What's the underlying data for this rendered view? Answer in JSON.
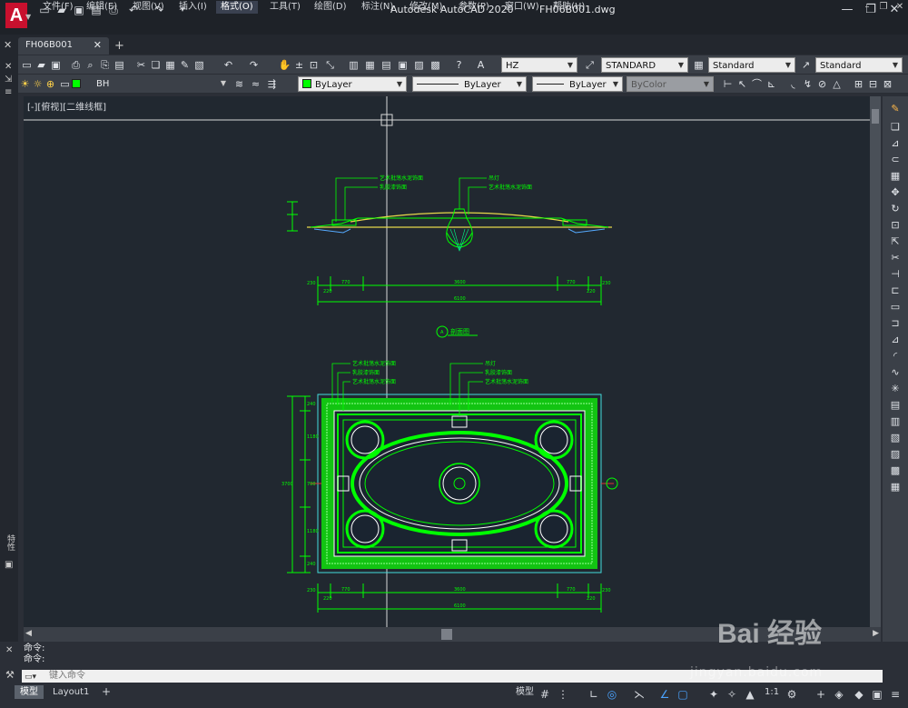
{
  "app": {
    "title": "Autodesk AutoCAD 2020",
    "file": "FH06B001.dwg"
  },
  "menu": [
    "文件(F)",
    "编辑(E)",
    "视图(V)",
    "插入(I)",
    "格式(O)",
    "工具(T)",
    "绘图(D)",
    "标注(N)",
    "修改(M)",
    "参数(P)",
    "窗口(W)",
    "帮助(H)"
  ],
  "menu_active": "格式(O)",
  "tabs": {
    "doc": "FH06B001",
    "add": "+"
  },
  "toolbar1": {
    "text_style": "HZ",
    "dim_style": "STANDARD",
    "table_style": "Standard",
    "mleader_style": "Standard"
  },
  "toolbar2": {
    "layer": "BH",
    "color": "ByLayer",
    "linetype": "ByLayer",
    "lineweight": "ByLayer",
    "plotstyle": "ByColor"
  },
  "viewport": {
    "label": "[-][俯视][二维线框]"
  },
  "drawing": {
    "elev_notes_left": [
      "艺术批荡水泥饰面",
      "乳胶漆饰面"
    ],
    "elev_notes_right": [
      "吊灯",
      "艺术批荡水泥饰面"
    ],
    "dims_top": [
      "230",
      "770",
      "3600",
      "770",
      "230"
    ],
    "dims_top_inner_left": "220",
    "dims_top_inner_right": "220",
    "total_width": "6100",
    "section_title": "剖面图",
    "section_mark": "A",
    "plan_notes_left": [
      "艺术批荡水泥饰面",
      "乳胶漆饰面",
      "艺术批荡水泥饰面"
    ],
    "plan_notes_right": [
      "吊灯",
      "乳胶漆饰面",
      "艺术批荡水泥饰面"
    ],
    "dims_left": [
      "240",
      "1180",
      "700",
      "1180",
      "240"
    ],
    "total_height": "3700",
    "dims_bottom": [
      "230",
      "770",
      "3600",
      "770",
      "230"
    ],
    "dims_bottom_inner_left": "220",
    "dims_bottom_inner_right": "220",
    "total_width_bottom": "6100"
  },
  "command": {
    "line1": "命令:",
    "line2": "命令:",
    "placeholder": "键入命令"
  },
  "layout_tabs": [
    "模型",
    "Layout1"
  ],
  "status": {
    "model": "模型",
    "scale": "1:1"
  },
  "watermark": {
    "main": "Bai 经验",
    "sub": "jingyan.baidu.com"
  }
}
